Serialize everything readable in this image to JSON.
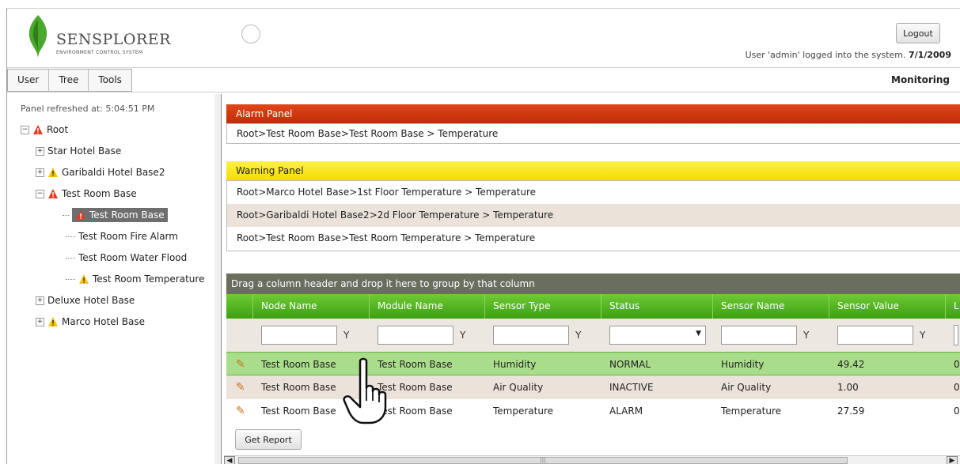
{
  "header": {
    "logo_title": "SENSPLORER",
    "logo_subtitle": "ENVIRONMENT CONTROL SYSTEM",
    "logout_label": "Logout",
    "login_text": "User 'admin' logged into the system.",
    "login_date": "7/1/2009"
  },
  "menu": {
    "items": [
      "User",
      "Tree",
      "Tools"
    ],
    "page_label": "Monitoring"
  },
  "tree": {
    "refresh_text": "Panel refreshed at: 5:04:51 PM",
    "root": "Root",
    "nodes": [
      "Star Hotel Base",
      "Garibaldi Hotel Base2",
      "Test Room Base",
      "Test Room Base",
      "Test Room Fire Alarm",
      "Test Room Water Flood",
      "Test Room Temperature",
      "Deluxe Hotel Base",
      "Marco Hotel Base"
    ]
  },
  "alarm_panel": {
    "title": "Alarm Panel",
    "items": [
      "Root>Test Room Base>Test Room Base > Temperature"
    ]
  },
  "warning_panel": {
    "title": "Warning Panel",
    "items": [
      "Root>Marco Hotel Base>1st Floor Temperature > Temperature",
      "Root>Garibaldi Hotel Base2>2d Floor Temperature > Temperature",
      "Root>Test Room Base>Test Room Temperature > Temperature"
    ]
  },
  "grid": {
    "group_hint": "Drag a column header and drop it here to group by that column",
    "columns": [
      "Node Name",
      "Module Name",
      "Sensor Type",
      "Status",
      "Sensor Name",
      "Sensor Value",
      "L"
    ],
    "rows": [
      [
        "Test Room Base",
        "Test Room Base",
        "Humidity",
        "NORMAL",
        "Humidity",
        "49.42",
        "0"
      ],
      [
        "Test Room Base",
        "Test Room Base",
        "Air Quality",
        "INACTIVE",
        "Air Quality",
        "1.00",
        "0"
      ],
      [
        "Test Room Base",
        "Test Room Base",
        "Temperature",
        "ALARM",
        "Temperature",
        "27.59",
        "0"
      ]
    ]
  },
  "report_label": "Get Report",
  "colors": {
    "alarm": "#c8340a",
    "warning": "#f8e100",
    "grid_header": "#52b222",
    "selected_row": "#a9dd8c"
  }
}
